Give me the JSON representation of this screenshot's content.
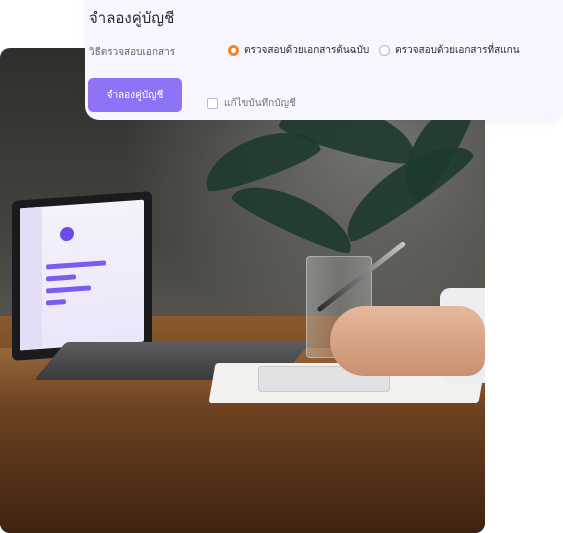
{
  "card": {
    "title": "จำลองคู่บัญชี",
    "method_label": "วิธีตรวจสอบเอกสาร",
    "options": [
      {
        "label": "ตรวจสอบด้วยเอกสารต้นฉบับ",
        "selected": true
      },
      {
        "label": "ตรวจสอบด้วยเอกสารที่สแกน",
        "selected": false
      }
    ],
    "primary_button": "จำลองคู่บัญชี",
    "checkbox_label": "แก้ไขบันทึกบัญชี",
    "checkbox_checked": false
  },
  "colors": {
    "accent": "#8f73f7",
    "radio_selected": "#f5832e",
    "card_bg": "#f7f5ff"
  }
}
